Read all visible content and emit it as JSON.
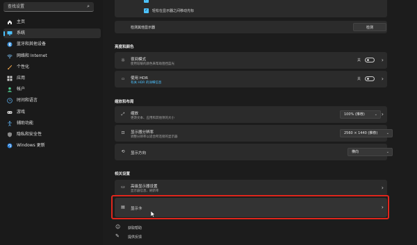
{
  "search": {
    "placeholder": "查找设置",
    "icon": "search-icon"
  },
  "sidebar": {
    "items": [
      {
        "label": "主页",
        "icon": "home-icon"
      },
      {
        "label": "系统",
        "icon": "monitor-icon",
        "active": true
      },
      {
        "label": "蓝牙和其他设备",
        "icon": "bluetooth-icon"
      },
      {
        "label": "网络和 Internet",
        "icon": "wifi-icon"
      },
      {
        "label": "个性化",
        "icon": "brush-icon"
      },
      {
        "label": "应用",
        "icon": "apps-icon"
      },
      {
        "label": "帐户",
        "icon": "person-icon"
      },
      {
        "label": "时间和语言",
        "icon": "globe-clock-icon"
      },
      {
        "label": "游戏",
        "icon": "gamepad-icon"
      },
      {
        "label": "辅助功能",
        "icon": "accessibility-icon"
      },
      {
        "label": "隐私和安全性",
        "icon": "shield-icon"
      },
      {
        "label": "Windows 更新",
        "icon": "refresh-icon"
      }
    ]
  },
  "top_card": {
    "checkbox_label": "轻松在显示器之间移动光标",
    "detect_text": "检测其他显示器",
    "detect_button": "检测"
  },
  "brightness_section": {
    "label": "亮度和颜色",
    "night_light": {
      "title": "夜间模式",
      "subtitle": "使用较暖的颜色来帮助阻挡蓝光",
      "toggle_label": "关"
    },
    "hdr": {
      "title": "使用 HDR",
      "subtitle": "有关 HDR 的详细信息",
      "toggle_label": "关"
    }
  },
  "scale_section": {
    "label": "缩放和布局",
    "scale": {
      "title": "缩放",
      "subtitle": "更改文本、应用和其他项的大小",
      "value": "100% (推荐)"
    },
    "resolution": {
      "title": "显示器分辨率",
      "subtitle": "调整分辨率以适合所连接的显示器",
      "value": "2560 × 1440 (推荐)"
    },
    "orientation": {
      "title": "显示方向",
      "value": "横向"
    }
  },
  "related_section": {
    "label": "相关设置",
    "advanced": {
      "title": "高级显示器设置",
      "subtitle": "显示器信息、刷新率"
    },
    "graphics": {
      "title": "显示卡"
    }
  },
  "links": {
    "help": "获取帮助",
    "feedback": "提供反馈"
  },
  "colors": {
    "accent": "#4cc2ff",
    "highlight": "#e0261c"
  }
}
